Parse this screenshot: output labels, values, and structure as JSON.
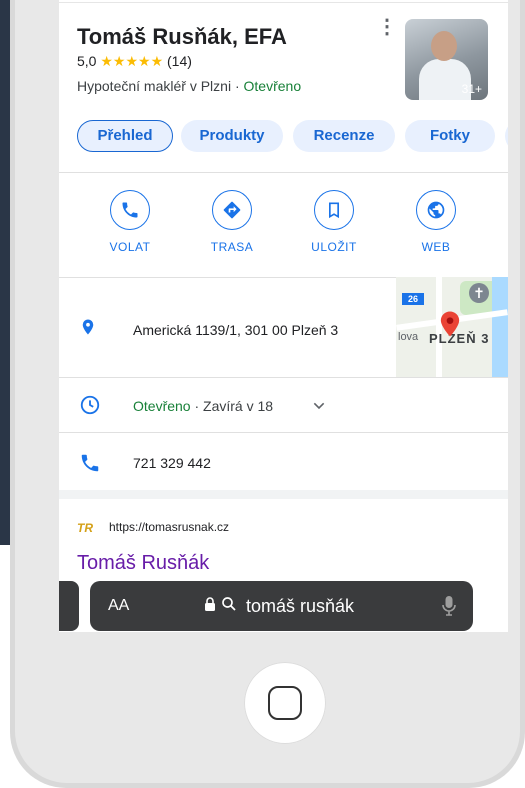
{
  "business": {
    "name": "Tomáš Rusňák, EFA",
    "rating": "5,0",
    "stars": "★★★★★",
    "review_count": "(14)",
    "category": "Hypoteční makléř v Plzni",
    "separator": "·",
    "status": "Otevřeno",
    "photo_count": "31+"
  },
  "tabs": [
    "Přehled",
    "Produkty",
    "Recenze",
    "Fotky"
  ],
  "actions": [
    "VOLAT",
    "TRASA",
    "ULOŽIT",
    "WEB"
  ],
  "address": "Americká 1139/1, 301 00 Plzeň 3",
  "map": {
    "city_label": "PLZEŇ 3",
    "street_label": "lova",
    "road_number": "26"
  },
  "hours": {
    "status": "Otevřeno",
    "separator": "·",
    "closes": "Zavírá v 18"
  },
  "phone": "721 329 442",
  "result": {
    "favicon": "TR",
    "url": "https://tomasrusnak.cz",
    "title": "Tomáš Rusňák"
  },
  "browser": {
    "text_size_label": "AA",
    "query": "tomáš rusňák"
  },
  "colors": {
    "accent": "#1a73e8",
    "open_green": "#188038",
    "star": "#fbbc04",
    "visited_link": "#681da8"
  }
}
